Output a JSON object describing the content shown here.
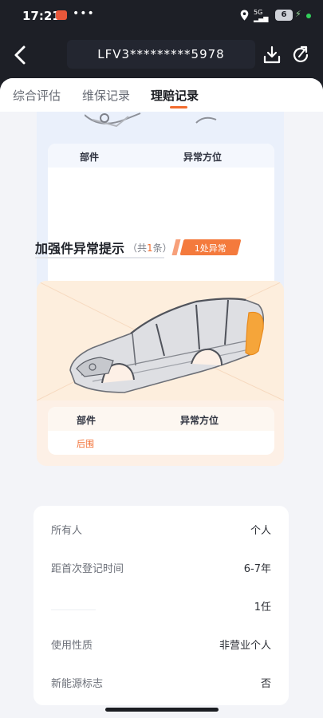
{
  "status_bar": {
    "time": "17:21",
    "dots": "•••",
    "signal_label": "5G",
    "battery": "6",
    "colors": {
      "app_icon": "#e8573a",
      "network_dot": "#32d05b"
    }
  },
  "nav": {
    "title": "LFV3*********5978",
    "icons": {
      "back": "chevron-left-icon",
      "download": "download-icon",
      "share": "share-refresh-icon"
    }
  },
  "tabs": [
    {
      "label": "综合评估",
      "active": false
    },
    {
      "label": "维保记录",
      "active": false
    },
    {
      "label": "理赔记录",
      "active": true
    }
  ],
  "top_table": {
    "col_part": "部件",
    "col_position": "异常方位"
  },
  "reinforcement": {
    "title": "加强件异常提示",
    "count_prefix": "（共",
    "count": "1",
    "count_suffix": "条）",
    "badge": "1处异常",
    "table": {
      "col_part": "部件",
      "col_position": "异常方位",
      "rows": [
        {
          "part": "后围",
          "position": ""
        }
      ]
    },
    "colors": {
      "accent": "#f26b2d",
      "highlight": "#f5a53a"
    }
  },
  "info": {
    "rows": [
      {
        "label": "所有人",
        "value": "个人"
      },
      {
        "label": "距首次登记时间",
        "value": "6-7年"
      },
      {
        "label": "",
        "value": "1任"
      },
      {
        "label": "使用性质",
        "value": "非营业个人"
      },
      {
        "label": "新能源标志",
        "value": "否"
      }
    ]
  }
}
